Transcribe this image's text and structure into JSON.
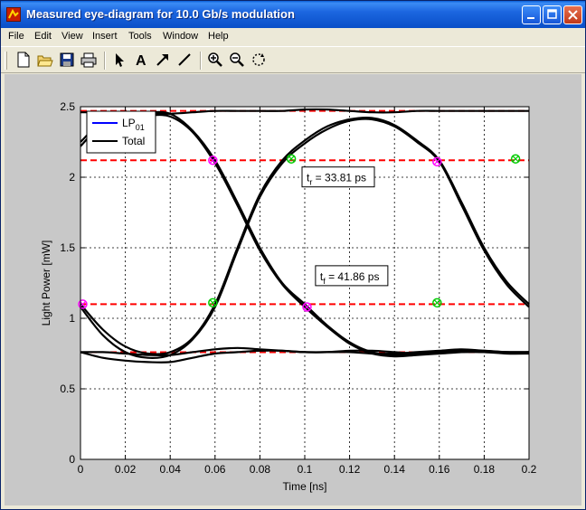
{
  "window": {
    "title": "Measured eye-diagram for 10.0 Gb/s modulation",
    "controls": [
      "minimize",
      "maximize",
      "close"
    ]
  },
  "menu": [
    "File",
    "Edit",
    "View",
    "Insert",
    "Tools",
    "Window",
    "Help"
  ],
  "toolbar": [
    "new-file-icon",
    "open-folder-icon",
    "save-icon",
    "print-icon",
    "pointer-arrow-icon",
    "insert-text-icon",
    "insert-arrow-icon",
    "insert-line-icon",
    "zoom-in-icon",
    "zoom-out-icon",
    "rotate-icon"
  ],
  "colors": {
    "lp01": "#0000ff",
    "total": "#000000",
    "threshold": "#ff0000",
    "magenta_marker": "#ff00ff",
    "green_marker": "#00cc00"
  },
  "chart_data": {
    "type": "line",
    "xlabel": "Time [ns]",
    "ylabel": "Light Power [mW]",
    "xlim": [
      0,
      0.2
    ],
    "ylim": [
      0,
      2.5
    ],
    "xticks": [
      0,
      0.02,
      0.04,
      0.06,
      0.08,
      0.1,
      0.12,
      0.14,
      0.16,
      0.18,
      0.2
    ],
    "xtick_labels": [
      "0",
      "0.02",
      "0.04",
      "0.06",
      "0.08",
      "0.1",
      "0.12",
      "0.14",
      "0.16",
      "0.18",
      "0.2"
    ],
    "yticks": [
      0,
      0.5,
      1,
      1.5,
      2,
      2.5
    ],
    "ytick_labels": [
      "0",
      "0.5",
      "1",
      "1.5",
      "2",
      "2.5"
    ],
    "grid": true,
    "legend": {
      "placement": "top-left",
      "entries": [
        {
          "label": "LP",
          "sub": "01",
          "color": "#0000ff"
        },
        {
          "label": "Total",
          "color": "#000000"
        }
      ]
    },
    "thresholds": [
      2.47,
      2.12,
      1.1,
      0.76
    ],
    "series": [
      {
        "x": [
          0,
          0.01,
          0.02,
          0.03,
          0.04,
          0.05,
          0.06,
          0.07,
          0.08,
          0.09,
          0.1,
          0.11,
          0.12,
          0.13,
          0.14,
          0.15,
          0.16,
          0.17,
          0.18,
          0.19,
          0.2
        ],
        "y": [
          2.25,
          2.4,
          2.46,
          2.46,
          2.45,
          2.33,
          2.12,
          1.82,
          1.5,
          1.25,
          1.1,
          0.95,
          0.83,
          0.76,
          0.74,
          0.75,
          0.76,
          0.77,
          0.77,
          0.76,
          0.76
        ]
      },
      {
        "x": [
          0,
          0.01,
          0.02,
          0.03,
          0.04,
          0.05,
          0.06,
          0.07,
          0.08,
          0.09,
          0.1,
          0.11,
          0.12,
          0.13,
          0.14,
          0.15,
          0.16,
          0.17,
          0.18,
          0.19,
          0.2
        ],
        "y": [
          2.22,
          2.38,
          2.44,
          2.44,
          2.43,
          2.32,
          2.1,
          1.8,
          1.48,
          1.24,
          1.08,
          0.94,
          0.82,
          0.75,
          0.73,
          0.74,
          0.75,
          0.76,
          0.76,
          0.75,
          0.75
        ]
      },
      {
        "x": [
          0,
          0.01,
          0.02,
          0.03,
          0.04,
          0.05,
          0.06,
          0.07,
          0.08,
          0.09,
          0.1,
          0.11,
          0.12,
          0.13,
          0.14,
          0.15,
          0.16,
          0.17,
          0.18,
          0.19,
          0.2
        ],
        "y": [
          1.1,
          0.92,
          0.8,
          0.75,
          0.76,
          0.86,
          1.1,
          1.5,
          1.88,
          2.12,
          2.26,
          2.36,
          2.41,
          2.42,
          2.37,
          2.26,
          2.12,
          1.82,
          1.5,
          1.26,
          1.1
        ]
      },
      {
        "x": [
          0,
          0.01,
          0.02,
          0.03,
          0.04,
          0.05,
          0.06,
          0.07,
          0.08,
          0.09,
          0.1,
          0.11,
          0.12,
          0.13,
          0.14,
          0.15,
          0.16,
          0.17,
          0.18,
          0.19,
          0.2
        ],
        "y": [
          1.08,
          0.88,
          0.76,
          0.72,
          0.74,
          0.85,
          1.08,
          1.48,
          1.86,
          2.1,
          2.24,
          2.34,
          2.4,
          2.41,
          2.36,
          2.25,
          2.11,
          1.8,
          1.48,
          1.24,
          1.08
        ]
      },
      {
        "x": [
          0,
          0.01,
          0.02,
          0.03,
          0.04,
          0.05,
          0.06,
          0.07,
          0.08,
          0.09,
          0.1,
          0.11,
          0.12,
          0.13,
          0.14,
          0.15,
          0.16,
          0.17,
          0.18,
          0.19,
          0.2
        ],
        "y": [
          0.76,
          0.72,
          0.7,
          0.69,
          0.69,
          0.72,
          0.75,
          0.76,
          0.77,
          0.77,
          0.76,
          0.76,
          0.77,
          0.77,
          0.76,
          0.75,
          0.76,
          0.77,
          0.76,
          0.76,
          0.76
        ]
      },
      {
        "x": [
          0,
          0.01,
          0.02,
          0.03,
          0.04,
          0.05,
          0.06,
          0.07,
          0.08,
          0.09,
          0.1,
          0.11,
          0.12,
          0.13,
          0.14,
          0.15,
          0.16,
          0.17,
          0.18,
          0.19,
          0.2
        ],
        "y": [
          2.46,
          2.46,
          2.46,
          2.45,
          2.45,
          2.46,
          2.47,
          2.47,
          2.47,
          2.47,
          2.48,
          2.48,
          2.47,
          2.46,
          2.46,
          2.47,
          2.47,
          2.47,
          2.47,
          2.47,
          2.47
        ]
      },
      {
        "x": [
          0,
          0.01,
          0.02,
          0.03,
          0.04,
          0.05,
          0.06,
          0.07,
          0.08,
          0.09,
          0.1,
          0.11,
          0.12,
          0.13,
          0.14,
          0.15,
          0.16,
          0.17,
          0.18,
          0.19,
          0.2
        ],
        "y": [
          0.76,
          0.76,
          0.75,
          0.74,
          0.74,
          0.76,
          0.78,
          0.79,
          0.78,
          0.77,
          0.76,
          0.76,
          0.76,
          0.75,
          0.75,
          0.76,
          0.77,
          0.78,
          0.77,
          0.76,
          0.76
        ]
      }
    ],
    "markers": {
      "magenta": [
        {
          "x": 0.001,
          "y": 1.1
        },
        {
          "x": 0.059,
          "y": 2.12
        },
        {
          "x": 0.101,
          "y": 1.08
        },
        {
          "x": 0.159,
          "y": 2.11
        }
      ],
      "green": [
        {
          "x": 0.059,
          "y": 1.11
        },
        {
          "x": 0.094,
          "y": 2.13
        },
        {
          "x": 0.159,
          "y": 1.11
        },
        {
          "x": 0.194,
          "y": 2.13
        }
      ]
    },
    "annotations": [
      {
        "label": "t",
        "sub": "r",
        "text": " = 33.81 ps",
        "x": 0.1,
        "y": 1.97
      },
      {
        "label": "t",
        "sub": "f",
        "text": " = 41.86 ps",
        "x": 0.106,
        "y": 1.27
      }
    ]
  }
}
